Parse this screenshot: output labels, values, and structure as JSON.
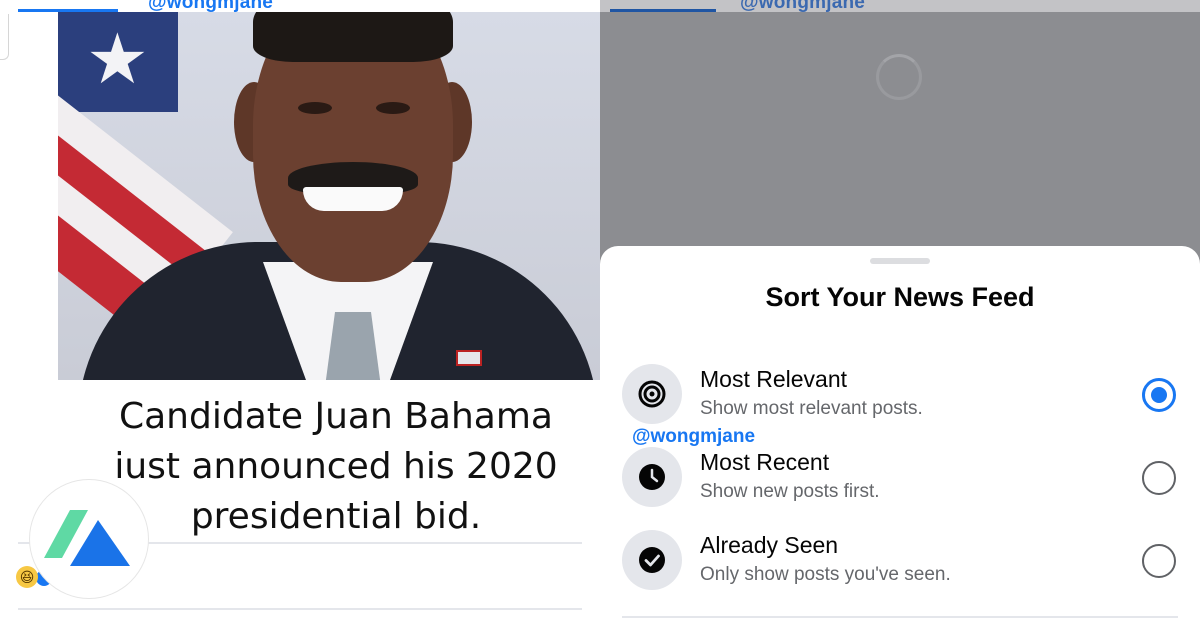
{
  "left_panel": {
    "handle": "@wongmjane",
    "meme_caption": [
      "Candidate Juan Bahama",
      "iust announced his 2020",
      "presidential bid."
    ],
    "reaction_emoji": "😆"
  },
  "right_panel": {
    "handle": "@wongmjane",
    "sheet": {
      "title": "Sort Your News Feed",
      "options": [
        {
          "label": "Most Relevant",
          "description": "Show most relevant posts.",
          "icon": "target-icon",
          "selected": true
        },
        {
          "label": "Most Recent",
          "description": "Show new posts first.",
          "icon": "clock-icon",
          "selected": false
        },
        {
          "label": "Already Seen",
          "description": "Only show posts you've seen.",
          "icon": "check-circle-icon",
          "selected": false
        }
      ]
    },
    "watermark": "@wongmjane"
  },
  "colors": {
    "accent": "#1877f2",
    "overlay": "#8c8d91",
    "logo_green": "#5fd9a4",
    "logo_blue": "#1a73e8"
  }
}
